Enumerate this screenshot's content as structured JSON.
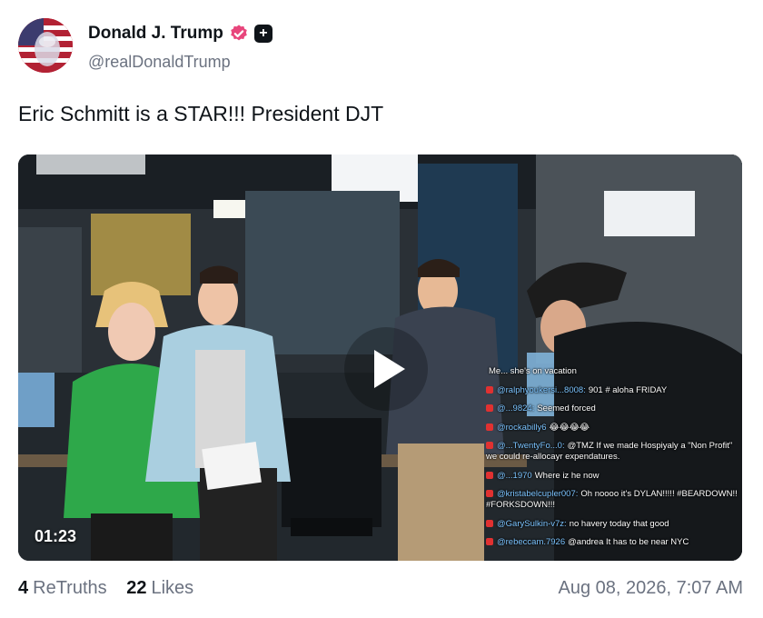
{
  "author": {
    "display_name": "Donald J. Trump",
    "handle": "@realDonaldTrump"
  },
  "post": {
    "text": "Eric Schmitt is a STAR!!! President DJT"
  },
  "video": {
    "duration": "01:23",
    "chat": [
      {
        "user": "",
        "text": "Me... she's on vacation"
      },
      {
        "user": "@ralphyoukersi...8008:",
        "text": "901 # aloha FRIDAY"
      },
      {
        "user": "@...9824:",
        "text": "Seemed forced"
      },
      {
        "user": "@rockabilly6",
        "text": "😂😂😂😂"
      },
      {
        "user": "@...TwentyFo...0:",
        "text": "@TMZ If we made Hospiyaly a \"Non Profit\" we could re-allocayr expendatures."
      },
      {
        "user": "@...1970",
        "text": "Where iz he now"
      },
      {
        "user": "@kristabelcupler007:",
        "text": "Oh noooo it's DYLAN!!!!! #BEARDOWN!! #FORKSDOWN!!!"
      },
      {
        "user": "@GarySulkin-v7z:",
        "text": "no havery today that good"
      },
      {
        "user": "@rebeccam.7926",
        "text": "@andrea It has to be near NYC"
      }
    ]
  },
  "stats": {
    "retruths_count": "4",
    "retruths_label": "ReTruths",
    "likes_count": "22",
    "likes_label": "Likes"
  },
  "timestamp": "Aug 08, 2026, 7:07 AM",
  "colors": {
    "verified_badge": "#e8467c",
    "text_primary": "#0f1419",
    "text_secondary": "#6b7280"
  }
}
